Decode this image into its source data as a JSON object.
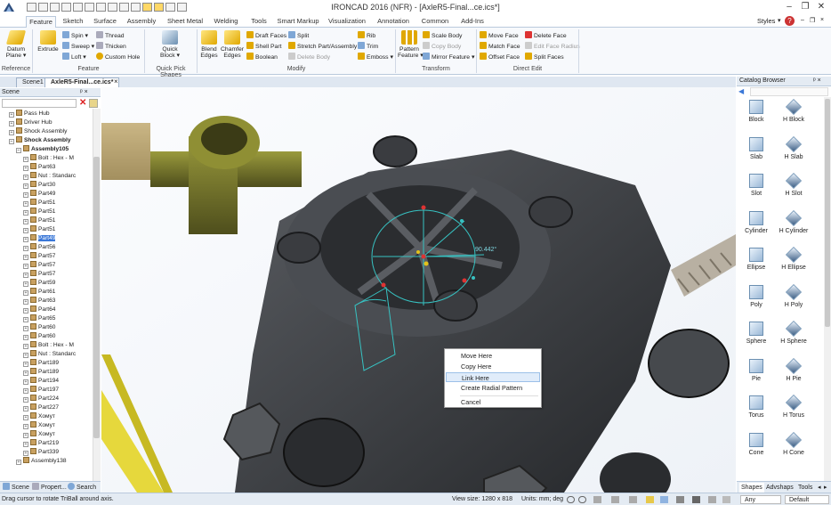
{
  "app": {
    "title": "IRONCAD 2016 (NFR) - [AxleR5-Final...ce.ics*]",
    "logo_icon": "ironcad-logo-icon"
  },
  "window": {
    "minimize": "–",
    "restore": "❐",
    "close": "✕"
  },
  "ribbon_tabs": [
    "Feature",
    "Sketch",
    "Surface",
    "Assembly",
    "Sheet Metal",
    "Welding",
    "Tools",
    "Smart Markup",
    "Visualization",
    "Annotation",
    "Common",
    "Add-Ins"
  ],
  "styles_label": "Styles",
  "ribbon": {
    "reference": {
      "label": "Reference",
      "datum": "Datum\nPlane ▾"
    },
    "feature": {
      "label": "Feature",
      "extrude": "Extrude",
      "spin": "Spin ▾",
      "sweep": "Sweep ▾",
      "loft": "Loft ▾",
      "thread": "Thread",
      "thicken": "Thicken",
      "custom_hole": "Custom Hole"
    },
    "quick_pick": {
      "label": "Quick Pick Shapes",
      "quick_block": "Quick\nBlock ▾"
    },
    "modify": {
      "label": "Modify",
      "blend": "Blend\nEdges",
      "chamfer": "Chamfer\nEdges",
      "draft": "Draft Faces",
      "shell": "Shell Part",
      "boolean": "Boolean",
      "split": "Split",
      "stretch": "Stretch Part/Assembly",
      "delete_body": "Delete Body",
      "rib": "Rib",
      "trim": "Trim",
      "emboss": "Emboss ▾"
    },
    "transform": {
      "label": "Transform",
      "pattern": "Pattern\nFeature ▾",
      "scale": "Scale Body",
      "copy": "Copy Body",
      "mirror": "Mirror Feature ▾"
    },
    "direct_edit": {
      "label": "Direct Edit",
      "move_face": "Move Face",
      "match_face": "Match Face",
      "offset_face": "Offset Face",
      "delete_face": "Delete Face",
      "edit_radius": "Edit Face Radius",
      "split_faces": "Split Faces"
    }
  },
  "doc_tabs": [
    "Scene1",
    "AxleR5-Final...ce.ics*"
  ],
  "doc_tab_close": "×",
  "scene_panel": {
    "title": "Scene",
    "pin": "ᵖ ×",
    "tree": [
      {
        "label": "Pass Hub",
        "indent": 1,
        "exp": "+"
      },
      {
        "label": "Driver Hub",
        "indent": 1,
        "exp": "+"
      },
      {
        "label": "Shock Assembly",
        "indent": 1,
        "exp": "+"
      },
      {
        "label": "Shock Assembly",
        "indent": 1,
        "exp": "−",
        "bold": true
      },
      {
        "label": "Assembly105",
        "indent": 2,
        "exp": "−",
        "bold": true
      },
      {
        "label": "Bolt : Hex - M",
        "indent": 3,
        "exp": "+"
      },
      {
        "label": "Part63",
        "indent": 3,
        "exp": "+"
      },
      {
        "label": "Nut : Standarc",
        "indent": 3,
        "exp": "+"
      },
      {
        "label": "Part30",
        "indent": 3,
        "exp": "+"
      },
      {
        "label": "Part49",
        "indent": 3,
        "exp": "+"
      },
      {
        "label": "Part51",
        "indent": 3,
        "exp": "+"
      },
      {
        "label": "Part51",
        "indent": 3,
        "exp": "+"
      },
      {
        "label": "Part51",
        "indent": 3,
        "exp": "+"
      },
      {
        "label": "Part51",
        "indent": 3,
        "exp": "+"
      },
      {
        "label": "Part49",
        "indent": 3,
        "exp": "+",
        "selected": true
      },
      {
        "label": "Part56",
        "indent": 3,
        "exp": "+"
      },
      {
        "label": "Part57",
        "indent": 3,
        "exp": "+"
      },
      {
        "label": "Part57",
        "indent": 3,
        "exp": "+"
      },
      {
        "label": "Part57",
        "indent": 3,
        "exp": "+"
      },
      {
        "label": "Part59",
        "indent": 3,
        "exp": "+"
      },
      {
        "label": "Part61",
        "indent": 3,
        "exp": "+"
      },
      {
        "label": "Part63",
        "indent": 3,
        "exp": "+"
      },
      {
        "label": "Part64",
        "indent": 3,
        "exp": "+"
      },
      {
        "label": "Part65",
        "indent": 3,
        "exp": "+"
      },
      {
        "label": "Part60",
        "indent": 3,
        "exp": "+"
      },
      {
        "label": "Part60",
        "indent": 3,
        "exp": "+"
      },
      {
        "label": "Bolt : Hex - M",
        "indent": 3,
        "exp": "+"
      },
      {
        "label": "Nut : Standarc",
        "indent": 3,
        "exp": "+"
      },
      {
        "label": "Part189",
        "indent": 3,
        "exp": "+"
      },
      {
        "label": "Part189",
        "indent": 3,
        "exp": "+"
      },
      {
        "label": "Part194",
        "indent": 3,
        "exp": "+"
      },
      {
        "label": "Part197",
        "indent": 3,
        "exp": "+"
      },
      {
        "label": "Part224",
        "indent": 3,
        "exp": "+"
      },
      {
        "label": "Part227",
        "indent": 3,
        "exp": "+"
      },
      {
        "label": "Хомут",
        "indent": 3,
        "exp": "+"
      },
      {
        "label": "Хомут",
        "indent": 3,
        "exp": "+"
      },
      {
        "label": "Хомут",
        "indent": 3,
        "exp": "+"
      },
      {
        "label": "Part219",
        "indent": 3,
        "exp": "+"
      },
      {
        "label": "Part339",
        "indent": 3,
        "exp": "+"
      },
      {
        "label": "Assembly138",
        "indent": 2,
        "exp": "+"
      }
    ],
    "bottom_tabs": [
      "Scene",
      "Propert...",
      "Search"
    ]
  },
  "viewport": {
    "angle_readout": "90.442°"
  },
  "context_menu": [
    "Move Here",
    "Copy Here",
    "Link Here",
    "Create Radial Pattern",
    "Cancel"
  ],
  "catalog": {
    "title": "Catalog Browser",
    "pin": "ᵖ ×",
    "items": [
      [
        "Block",
        "H Block"
      ],
      [
        "Slab",
        "H Slab"
      ],
      [
        "Slot",
        "H Slot"
      ],
      [
        "Cylinder",
        "H Cylinder"
      ],
      [
        "Ellipse",
        "H Ellipse"
      ],
      [
        "Poly",
        "H Poly"
      ],
      [
        "Sphere",
        "H Sphere"
      ],
      [
        "Pie",
        "H Pie"
      ],
      [
        "Torus",
        "H Torus"
      ],
      [
        "Cone",
        "H Cone"
      ]
    ],
    "bottom_tabs": [
      "Shapes",
      "Advshaps",
      "Tools"
    ]
  },
  "status": {
    "hint": "Drag cursor to rotate TriBall around axis.",
    "view_size": "View size: 1280 x 818",
    "units": "Units: mm; deg",
    "any": "Any",
    "default": "Default"
  },
  "colors": {
    "accent": "#3b78d8",
    "ribbon_bg": "#f7f9fc",
    "panel_head": "#e4ebf3",
    "viewport_bg": "#3b3f45"
  }
}
